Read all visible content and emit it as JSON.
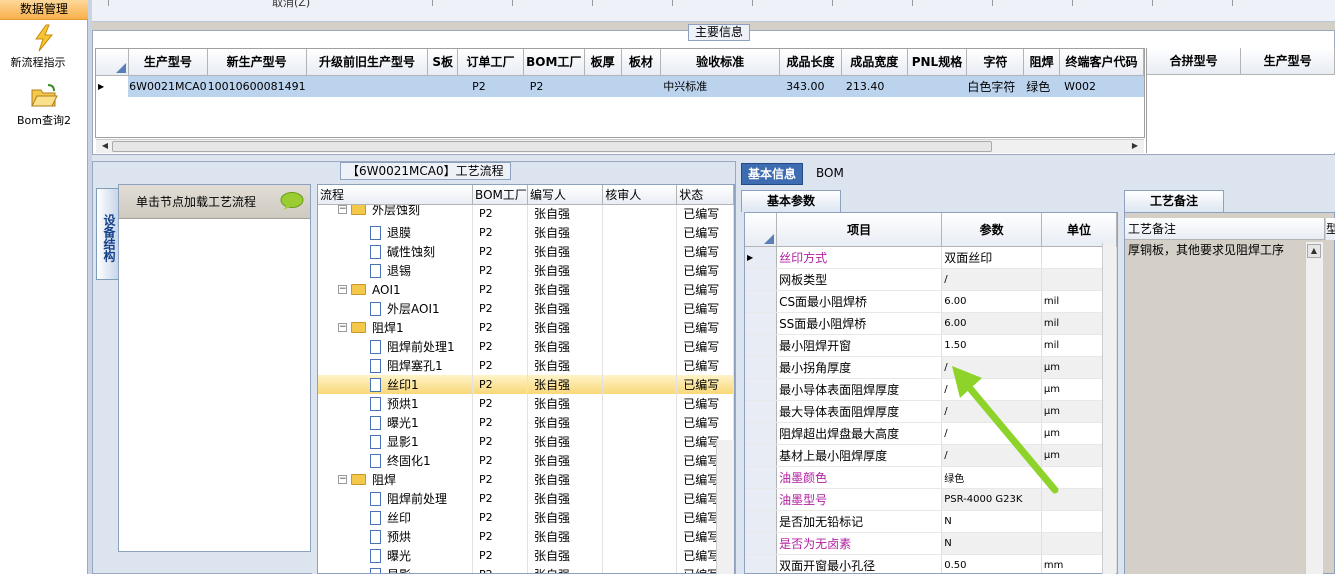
{
  "nav": {
    "header": "数据管理",
    "items": [
      {
        "label": "新流程指示",
        "icon": "lightning-icon"
      },
      {
        "label": "Bom查询2",
        "icon": "open-folder-icon"
      }
    ]
  },
  "toolbar": {
    "cancel_label": "取消(Z)"
  },
  "main_info": {
    "title": "主要信息",
    "columns": [
      "生产型号",
      "新生产型号",
      "升级前旧生产型号",
      "S板",
      "订单工厂",
      "BOM工厂",
      "板厚",
      "板材",
      "验收标准",
      "成品长度",
      "成品宽度",
      "PNL规格",
      "字符",
      "阻焊",
      "终端客户代码"
    ],
    "row": [
      "6W0021MCA0",
      "10010600081491",
      "",
      "",
      "P2",
      "P2",
      "",
      "",
      "中兴标准",
      "343.00",
      "213.40",
      "",
      "白色字符",
      "绿色",
      "W002"
    ],
    "side_columns": [
      "合拼型号",
      "生产型号"
    ]
  },
  "flow": {
    "title": "【6W0021MCA0】工艺流程",
    "device_tab": "设备结构",
    "load_hint": "单击节点加载工艺流程",
    "columns": [
      "流程",
      "BOM工厂",
      "编写人",
      "核审人",
      "状态"
    ],
    "rows": [
      {
        "name": "外层蚀刻",
        "type": "folder",
        "level": 0,
        "factory": "P2",
        "writer": "张自强",
        "reviewer": "",
        "status": "已编写",
        "partial": true
      },
      {
        "name": "退膜",
        "type": "doc",
        "level": 1,
        "factory": "P2",
        "writer": "张自强",
        "reviewer": "",
        "status": "已编写"
      },
      {
        "name": "碱性蚀刻",
        "type": "doc",
        "level": 1,
        "factory": "P2",
        "writer": "张自强",
        "reviewer": "",
        "status": "已编写"
      },
      {
        "name": "退锡",
        "type": "doc",
        "level": 1,
        "factory": "P2",
        "writer": "张自强",
        "reviewer": "",
        "status": "已编写"
      },
      {
        "name": "AOI1",
        "type": "folder",
        "level": 0,
        "factory": "P2",
        "writer": "张自强",
        "reviewer": "",
        "status": "已编写"
      },
      {
        "name": "外层AOI1",
        "type": "doc",
        "level": 1,
        "factory": "P2",
        "writer": "张自强",
        "reviewer": "",
        "status": "已编写"
      },
      {
        "name": "阻焊1",
        "type": "folder",
        "level": 0,
        "factory": "P2",
        "writer": "张自强",
        "reviewer": "",
        "status": "已编写"
      },
      {
        "name": "阻焊前处理1",
        "type": "doc",
        "level": 1,
        "factory": "P2",
        "writer": "张自强",
        "reviewer": "",
        "status": "已编写"
      },
      {
        "name": "阻焊塞孔1",
        "type": "doc",
        "level": 1,
        "factory": "P2",
        "writer": "张自强",
        "reviewer": "",
        "status": "已编写"
      },
      {
        "name": "丝印1",
        "type": "doc",
        "level": 1,
        "factory": "P2",
        "writer": "张自强",
        "reviewer": "",
        "status": "已编写",
        "selected": true
      },
      {
        "name": "预烘1",
        "type": "doc",
        "level": 1,
        "factory": "P2",
        "writer": "张自强",
        "reviewer": "",
        "status": "已编写"
      },
      {
        "name": "曝光1",
        "type": "doc",
        "level": 1,
        "factory": "P2",
        "writer": "张自强",
        "reviewer": "",
        "status": "已编写"
      },
      {
        "name": "显影1",
        "type": "doc",
        "level": 1,
        "factory": "P2",
        "writer": "张自强",
        "reviewer": "",
        "status": "已编写"
      },
      {
        "name": "终固化1",
        "type": "doc",
        "level": 1,
        "factory": "P2",
        "writer": "张自强",
        "reviewer": "",
        "status": "已编写"
      },
      {
        "name": "阻焊",
        "type": "folder",
        "level": 0,
        "factory": "P2",
        "writer": "张自强",
        "reviewer": "",
        "status": "已编写"
      },
      {
        "name": "阻焊前处理",
        "type": "doc",
        "level": 1,
        "factory": "P2",
        "writer": "张自强",
        "reviewer": "",
        "status": "已编写"
      },
      {
        "name": "丝印",
        "type": "doc",
        "level": 1,
        "factory": "P2",
        "writer": "张自强",
        "reviewer": "",
        "status": "已编写"
      },
      {
        "name": "预烘",
        "type": "doc",
        "level": 1,
        "factory": "P2",
        "writer": "张自强",
        "reviewer": "",
        "status": "已编写"
      },
      {
        "name": "曝光",
        "type": "doc",
        "level": 1,
        "factory": "P2",
        "writer": "张自强",
        "reviewer": "",
        "status": "已编写"
      },
      {
        "name": "显影",
        "type": "doc",
        "level": 1,
        "factory": "P2",
        "writer": "张自强",
        "reviewer": "",
        "status": "已编写"
      }
    ]
  },
  "details": {
    "tabs": [
      "基本信息",
      "BOM"
    ],
    "subtab": "基本参数",
    "columns": [
      "项目",
      "参数",
      "单位"
    ],
    "rows": [
      {
        "item": "丝印方式",
        "value": "双面丝印",
        "unit": "",
        "pink": true,
        "current": true
      },
      {
        "item": "网板类型",
        "value": "/",
        "unit": ""
      },
      {
        "item": "CS面最小阻焊桥",
        "value": "6.00",
        "unit": "mil"
      },
      {
        "item": "SS面最小阻焊桥",
        "value": "6.00",
        "unit": "mil"
      },
      {
        "item": "最小阻焊开窗",
        "value": "1.50",
        "unit": "mil"
      },
      {
        "item": "最小拐角厚度",
        "value": "/",
        "unit": "μm"
      },
      {
        "item": "最小导体表面阻焊厚度",
        "value": "/",
        "unit": "μm"
      },
      {
        "item": "最大导体表面阻焊厚度",
        "value": "/",
        "unit": "μm"
      },
      {
        "item": "阻焊超出焊盘最大高度",
        "value": "/",
        "unit": "μm"
      },
      {
        "item": "基材上最小阻焊厚度",
        "value": "/",
        "unit": "μm"
      },
      {
        "item": "油墨颜色",
        "value": "绿色",
        "unit": "",
        "pink": true
      },
      {
        "item": "油墨型号",
        "value": "PSR-4000 G23K",
        "unit": "",
        "pink": true
      },
      {
        "item": "是否加无铅标记",
        "value": "N",
        "unit": ""
      },
      {
        "item": "是否为无卤素",
        "value": "N",
        "unit": "",
        "pink": true
      },
      {
        "item": "双面开窗最小孔径",
        "value": "0.50",
        "unit": "mm"
      }
    ]
  },
  "remarks": {
    "tab": "工艺备注",
    "header": "工艺备注",
    "header2": "型",
    "text": "厚铜板，其他要求见阻焊工序"
  },
  "colors": {
    "selection": "#bcd3ee",
    "tab_active": "#3d6cb0",
    "pink": "#b020a0",
    "highlight": "#f9d87a",
    "arrow": "#8ed32a"
  }
}
